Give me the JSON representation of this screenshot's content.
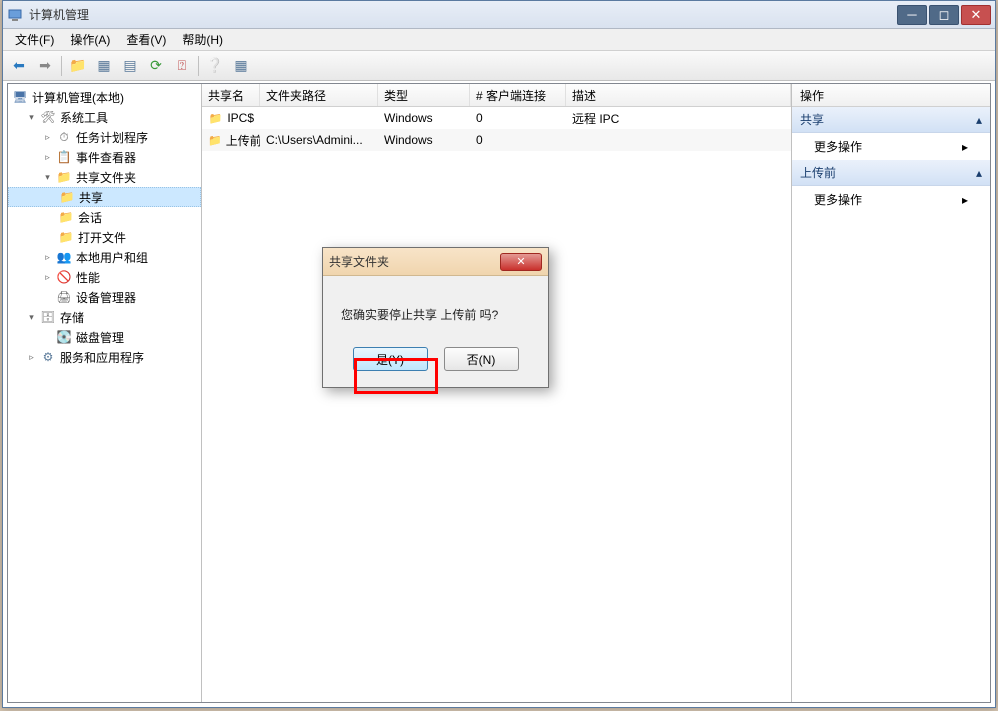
{
  "window": {
    "title": "计算机管理"
  },
  "menu": {
    "file": "文件(F)",
    "action": "操作(A)",
    "view": "查看(V)",
    "help": "帮助(H)"
  },
  "tree": {
    "root": "计算机管理(本地)",
    "systools": "系统工具",
    "task": "任务计划程序",
    "event": "事件查看器",
    "shared": "共享文件夹",
    "shares": "共享",
    "sessions": "会话",
    "openfiles": "打开文件",
    "users": "本地用户和组",
    "perf": "性能",
    "device": "设备管理器",
    "storage": "存储",
    "disk": "磁盘管理",
    "services": "服务和应用程序"
  },
  "columns": {
    "name": "共享名",
    "path": "文件夹路径",
    "type": "类型",
    "clients": "# 客户端连接",
    "desc": "描述"
  },
  "col_widths": {
    "name": 58,
    "path": 118,
    "type": 92,
    "clients": 96,
    "desc": 150
  },
  "rows": [
    {
      "name": "IPC$",
      "path": "",
      "type": "Windows",
      "clients": "0",
      "desc": "远程 IPC"
    },
    {
      "name": "上传前",
      "path": "C:\\Users\\Admini...",
      "type": "Windows",
      "clients": "0",
      "desc": ""
    }
  ],
  "actions": {
    "title": "操作",
    "group1": "共享",
    "more": "更多操作",
    "group2": "上传前"
  },
  "dialog": {
    "title": "共享文件夹",
    "message": "您确实要停止共享 上传前 吗?",
    "yes": "是(Y)",
    "no": "否(N)"
  }
}
